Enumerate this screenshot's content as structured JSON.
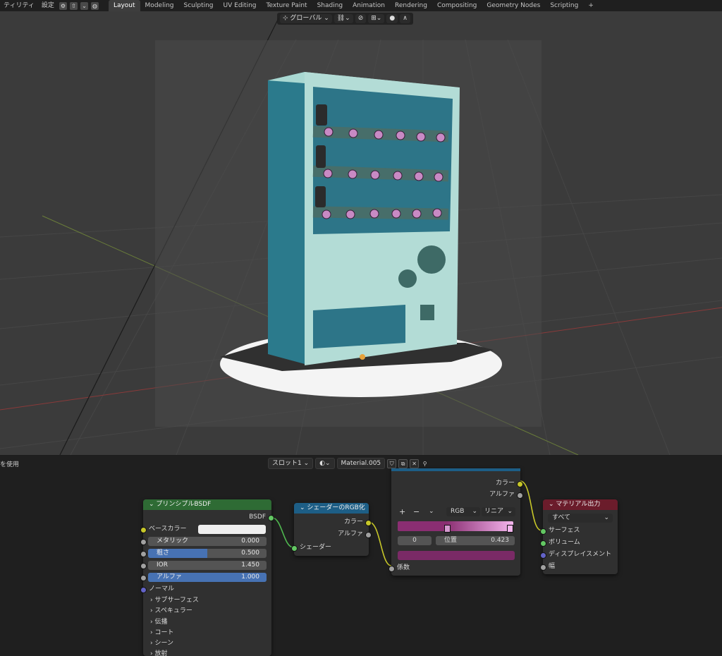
{
  "topbar": {
    "menu": [
      "ティリティ",
      "設定"
    ],
    "tabs": [
      "Layout",
      "Modeling",
      "Sculpting",
      "UV Editing",
      "Texture Paint",
      "Shading",
      "Animation",
      "Rendering",
      "Compositing",
      "Geometry Nodes",
      "Scripting"
    ],
    "active_tab": "Layout",
    "add_tab": "+"
  },
  "viewport_header": {
    "transform_orientation": "グローバル"
  },
  "node_editor": {
    "header_left": "を使用",
    "slot": "スロット1",
    "material": "Material.005"
  },
  "colors": {
    "bsdf_header": "#2e6b34",
    "shader_rgb_header": "#1d5e86",
    "material_output_header": "#6b1c2b",
    "ramp_start": "#8a2e72",
    "ramp_end": "#f5b6ee",
    "ramp_output": "#7a2a66"
  },
  "nodes": {
    "bsdf": {
      "title": "プリンシプルBSDF",
      "output": "BSDF",
      "inputs": {
        "base_color": "ベースカラー",
        "metallic_label": "メタリック",
        "metallic_value": "0.000",
        "roughness_label": "粗さ",
        "roughness_value": "0.500",
        "ior_label": "IOR",
        "ior_value": "1.450",
        "alpha_label": "アルファ",
        "alpha_value": "1.000",
        "normal": "ノーマル"
      },
      "panels": [
        "サブサーフェス",
        "スペキュラー",
        "伝播",
        "コート",
        "シーン",
        "放射"
      ]
    },
    "shader_to_rgb": {
      "title": "シェーダーのRGB化",
      "out_color": "カラー",
      "out_alpha": "アルファ",
      "in_shader": "シェーダー"
    },
    "color_ramp": {
      "out_color": "カラー",
      "out_alpha": "アルファ",
      "add": "+",
      "remove": "−",
      "color_mode": "RGB",
      "interpolation": "リニア",
      "stop_index": "0",
      "position_label": "位置",
      "position_value": "0.423",
      "in_factor": "係数"
    },
    "material_output": {
      "title": "マテリアル出力",
      "target": "すべて",
      "surface": "サーフェス",
      "volume": "ボリューム",
      "displacement": "ディスプレイスメント",
      "thickness": "幅"
    }
  }
}
